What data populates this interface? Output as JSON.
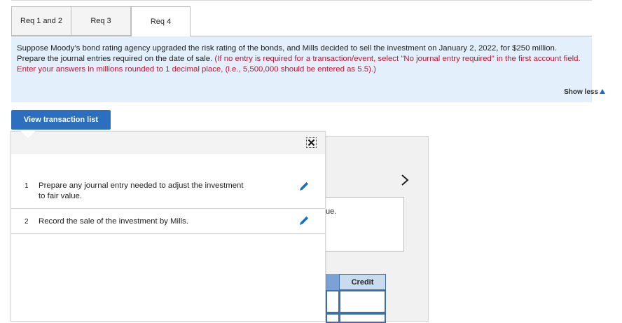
{
  "tabs": [
    {
      "label": "Req 1 and 2",
      "active": false
    },
    {
      "label": "Req 3",
      "active": false
    },
    {
      "label": "Req 4",
      "active": true
    }
  ],
  "instructions": {
    "text": "Suppose Moody’s bond rating agency upgraded the risk rating of the bonds, and Mills decided to sell the investment on January 2, 2022, for $250 million. Prepare the journal entries required on the date of sale.",
    "note": "(If no entry is required for a transaction/event, select \"No journal entry required\" in the first account field. Enter your answers in millions rounded to 1 decimal place, (i.e., 5,500,000 should be entered as 5.5).)",
    "note_color": "#c8102e",
    "show_less": "Show less"
  },
  "view_button": "View transaction list",
  "transactions": [
    {
      "num": "1",
      "text": "Prepare any journal entry needed to adjust the investment to fair value."
    },
    {
      "num": "2",
      "text": "Record the sale of the investment by Mills."
    }
  ],
  "background": {
    "partial_text": "ue.",
    "credit_header": "Credit"
  },
  "colors": {
    "accent": "#2c6fbe",
    "info_bg": "#e3f0fb",
    "pencil": "#1a6fc4"
  }
}
